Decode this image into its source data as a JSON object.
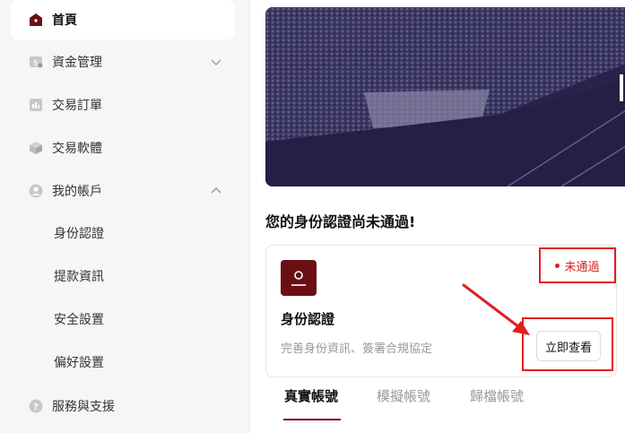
{
  "sidebar": {
    "items": [
      {
        "label": "首頁",
        "icon": "home-icon"
      },
      {
        "label": "資金管理",
        "icon": "wallet-icon"
      },
      {
        "label": "交易訂單",
        "icon": "orders-chart-icon"
      },
      {
        "label": "交易軟體",
        "icon": "box-icon"
      },
      {
        "label": "我的帳戶",
        "icon": "user-icon"
      },
      {
        "label": "服務與支援",
        "icon": "help-icon"
      }
    ],
    "sub_items": [
      "身份認證",
      "提款資訊",
      "安全設置",
      "偏好設置"
    ]
  },
  "main": {
    "section_title": "您的身份認證尚未通過!",
    "card": {
      "title": "身份認證",
      "description": "完善身份資訊、簽署合規協定",
      "status": "未通過",
      "button_label": "立即查看"
    },
    "tabs": [
      {
        "label": "真實帳號",
        "active": true
      },
      {
        "label": "模擬帳號",
        "active": false
      },
      {
        "label": "歸檔帳號",
        "active": false
      }
    ]
  },
  "colors": {
    "brand": "#6b0f14",
    "status_red": "#d42020",
    "highlight_red": "#e02020"
  }
}
